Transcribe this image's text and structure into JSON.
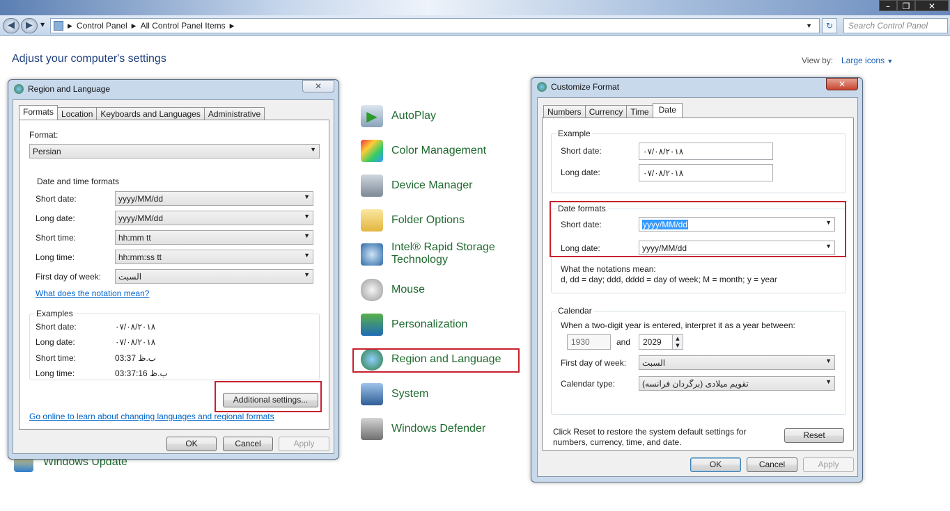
{
  "explorer": {
    "breadcrumb": [
      "Control Panel",
      "All Control Panel Items"
    ],
    "search_placeholder": "Search Control Panel",
    "page_title": "Adjust your computer's settings",
    "view_by_label": "View by:",
    "view_by_value": "Large icons",
    "partial_bottom_item": "Windows Update",
    "items": [
      {
        "label": "AutoPlay",
        "icon": "autoplay-icon"
      },
      {
        "label": "Color Management",
        "icon": "color-management-icon"
      },
      {
        "label": "Device Manager",
        "icon": "device-manager-icon"
      },
      {
        "label": "Folder Options",
        "icon": "folder-options-icon"
      },
      {
        "label": "Intel® Rapid Storage Technology",
        "line1": "Intel® Rapid Storage",
        "line2": "Technology",
        "icon": "intel-storage-icon"
      },
      {
        "label": "Mouse",
        "icon": "mouse-icon"
      },
      {
        "label": "Personalization",
        "icon": "personalization-icon"
      },
      {
        "label": "Region and Language",
        "icon": "region-language-icon"
      },
      {
        "label": "System",
        "icon": "system-icon"
      },
      {
        "label": "Windows Defender",
        "icon": "windows-defender-icon"
      }
    ]
  },
  "region": {
    "title": "Region and Language",
    "tabs": [
      "Formats",
      "Location",
      "Keyboards and Languages",
      "Administrative"
    ],
    "format_label": "Format:",
    "format_value": "Persian",
    "dt_group": "Date and time formats",
    "rows": [
      {
        "label": "Short date:",
        "value": "yyyy/MM/dd"
      },
      {
        "label": "Long date:",
        "value": "yyyy/MM/dd"
      },
      {
        "label": "Short time:",
        "value": "hh:mm tt"
      },
      {
        "label": "Long time:",
        "value": "hh:mm:ss tt"
      },
      {
        "label": "First day of week:",
        "value": "السبت"
      }
    ],
    "notation_link": "What does the notation mean?",
    "examples_group": "Examples",
    "examples": [
      {
        "label": "Short date:",
        "value": "۰۷/۰۸/۲۰۱۸"
      },
      {
        "label": "Long date:",
        "value": "۰۷/۰۸/۲۰۱۸"
      },
      {
        "label": "Short time:",
        "value": "03:37 ب.ظ"
      },
      {
        "label": "Long time:",
        "value": "03:37:16 ب.ظ"
      }
    ],
    "additional_button": "Additional settings...",
    "online_link": "Go online to learn about changing languages and regional formats",
    "ok": "OK",
    "cancel": "Cancel",
    "apply": "Apply"
  },
  "customize": {
    "title": "Customize Format",
    "tabs": [
      "Numbers",
      "Currency",
      "Time",
      "Date"
    ],
    "example_group": "Example",
    "ex_short_label": "Short date:",
    "ex_short_value": "۰۷/۰۸/۲۰۱۸",
    "ex_long_label": "Long date:",
    "ex_long_value": "۰۷/۰۸/۲۰۱۸",
    "formats_group": "Date formats",
    "fmt_short_label": "Short date:",
    "fmt_short_value": "yyyy/MM/dd",
    "fmt_long_label": "Long date:",
    "fmt_long_value": "yyyy/MM/dd",
    "notation_title": "What the notations mean:",
    "notation_text": "d, dd = day;  ddd, dddd = day of week;  M = month;  y = year",
    "calendar_group": "Calendar",
    "two_digit_text": "When a two-digit year is entered, interpret it as a year between:",
    "year_from": "1930",
    "and_label": "and",
    "year_to": "2029",
    "first_day_label": "First day of week:",
    "first_day_value": "السبت",
    "cal_type_label": "Calendar type:",
    "cal_type_value": "تقویم میلادی (برگردان فرانسه)",
    "reset_text_1": "Click Reset to restore the system default settings for",
    "reset_text_2": "numbers, currency, time, and date.",
    "reset": "Reset",
    "ok": "OK",
    "cancel": "Cancel",
    "apply": "Apply"
  }
}
